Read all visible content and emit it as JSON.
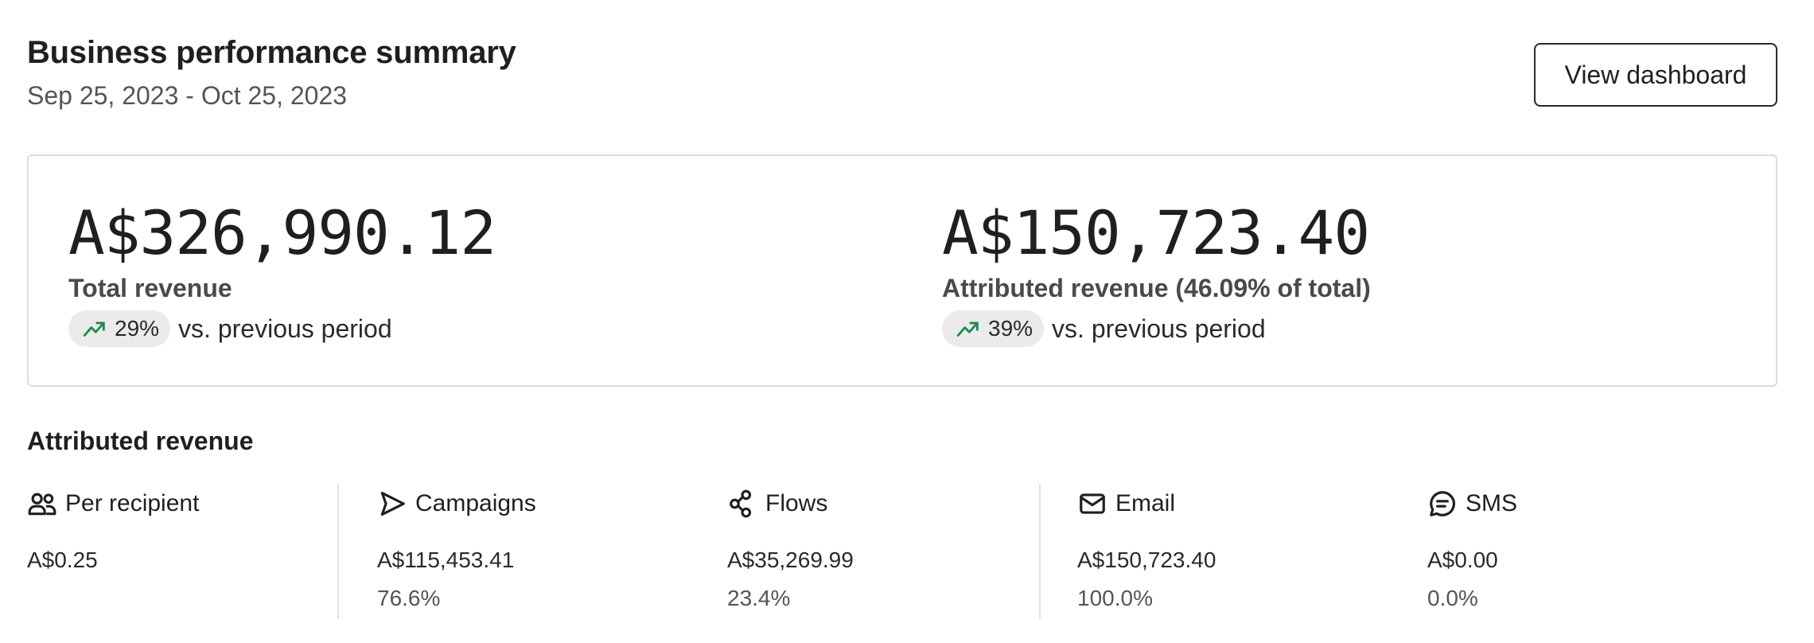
{
  "header": {
    "title": "Business performance summary",
    "date_range": "Sep 25, 2023 - Oct 25, 2023",
    "view_dashboard_label": "View dashboard"
  },
  "summary": {
    "total": {
      "value": "A$326,990.12",
      "label": "Total revenue",
      "change": "29%",
      "change_suffix": "vs. previous period"
    },
    "attributed": {
      "value": "A$150,723.40",
      "label": "Attributed revenue (46.09% of total)",
      "change": "39%",
      "change_suffix": "vs. previous period"
    },
    "trend_icon": "trending-up-icon",
    "trend_color": "#1f8a4c"
  },
  "attributed_section": {
    "title": "Attributed revenue",
    "stats": [
      {
        "name": "Per recipient",
        "icon": "users-icon",
        "value": "A$0.25",
        "pct": ""
      },
      {
        "name": "Campaigns",
        "icon": "send-icon",
        "value": "A$115,453.41",
        "pct": "76.6%"
      },
      {
        "name": "Flows",
        "icon": "flows-icon",
        "value": "A$35,269.99",
        "pct": "23.4%"
      },
      {
        "name": "Email",
        "icon": "mail-icon",
        "value": "A$150,723.40",
        "pct": "100.0%"
      },
      {
        "name": "SMS",
        "icon": "sms-icon",
        "value": "A$0.00",
        "pct": "0.0%"
      }
    ]
  },
  "colors": {
    "text": "#1f1f1f",
    "muted": "#555555",
    "border": "#dcdcdc",
    "pill_bg": "#ebebeb"
  }
}
